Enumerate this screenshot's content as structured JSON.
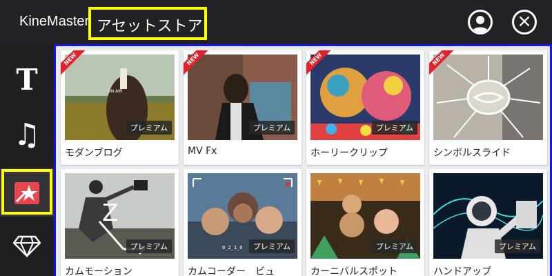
{
  "header": {
    "app_name": "KineMaster",
    "store_title": "アセットストア",
    "account_icon": "user-icon",
    "close_icon": "close-icon"
  },
  "sidebar": {
    "items": [
      {
        "name": "text",
        "glyph": "T",
        "icon": "text-icon"
      },
      {
        "name": "music",
        "glyph": "♫",
        "icon": "music-note-icon"
      },
      {
        "name": "effects",
        "glyph": "",
        "icon": "star-clapper-icon",
        "active": true
      },
      {
        "name": "premium",
        "glyph": "",
        "icon": "diamond-icon"
      }
    ]
  },
  "badges": {
    "premium_label": "プレミアム",
    "new_label": "NEW"
  },
  "assets": [
    {
      "title": "モダンブログ",
      "new": true,
      "premium": true,
      "overlay_text": "ON AIR"
    },
    {
      "title": "MV Fx",
      "new": true,
      "premium": true
    },
    {
      "title": "ホーリークリップ",
      "new": true,
      "premium": true
    },
    {
      "title": "シンボルスライド",
      "new": true,
      "premium": false
    },
    {
      "title": "カムモーション",
      "new": false,
      "premium": true,
      "overlay_text": "Z"
    },
    {
      "title": "カムコーダー　ビュ",
      "new": false,
      "premium": true,
      "overlay_text": "0_2_1_0"
    },
    {
      "title": "カーニバルスポット",
      "new": false,
      "premium": true
    },
    {
      "title": "ハンドアップ",
      "new": false,
      "premium": true
    }
  ],
  "colors": {
    "highlight": "#ffff00",
    "content_border": "#1414ee",
    "new_ribbon": "#e5212c",
    "active_icon": "#e8464e"
  }
}
